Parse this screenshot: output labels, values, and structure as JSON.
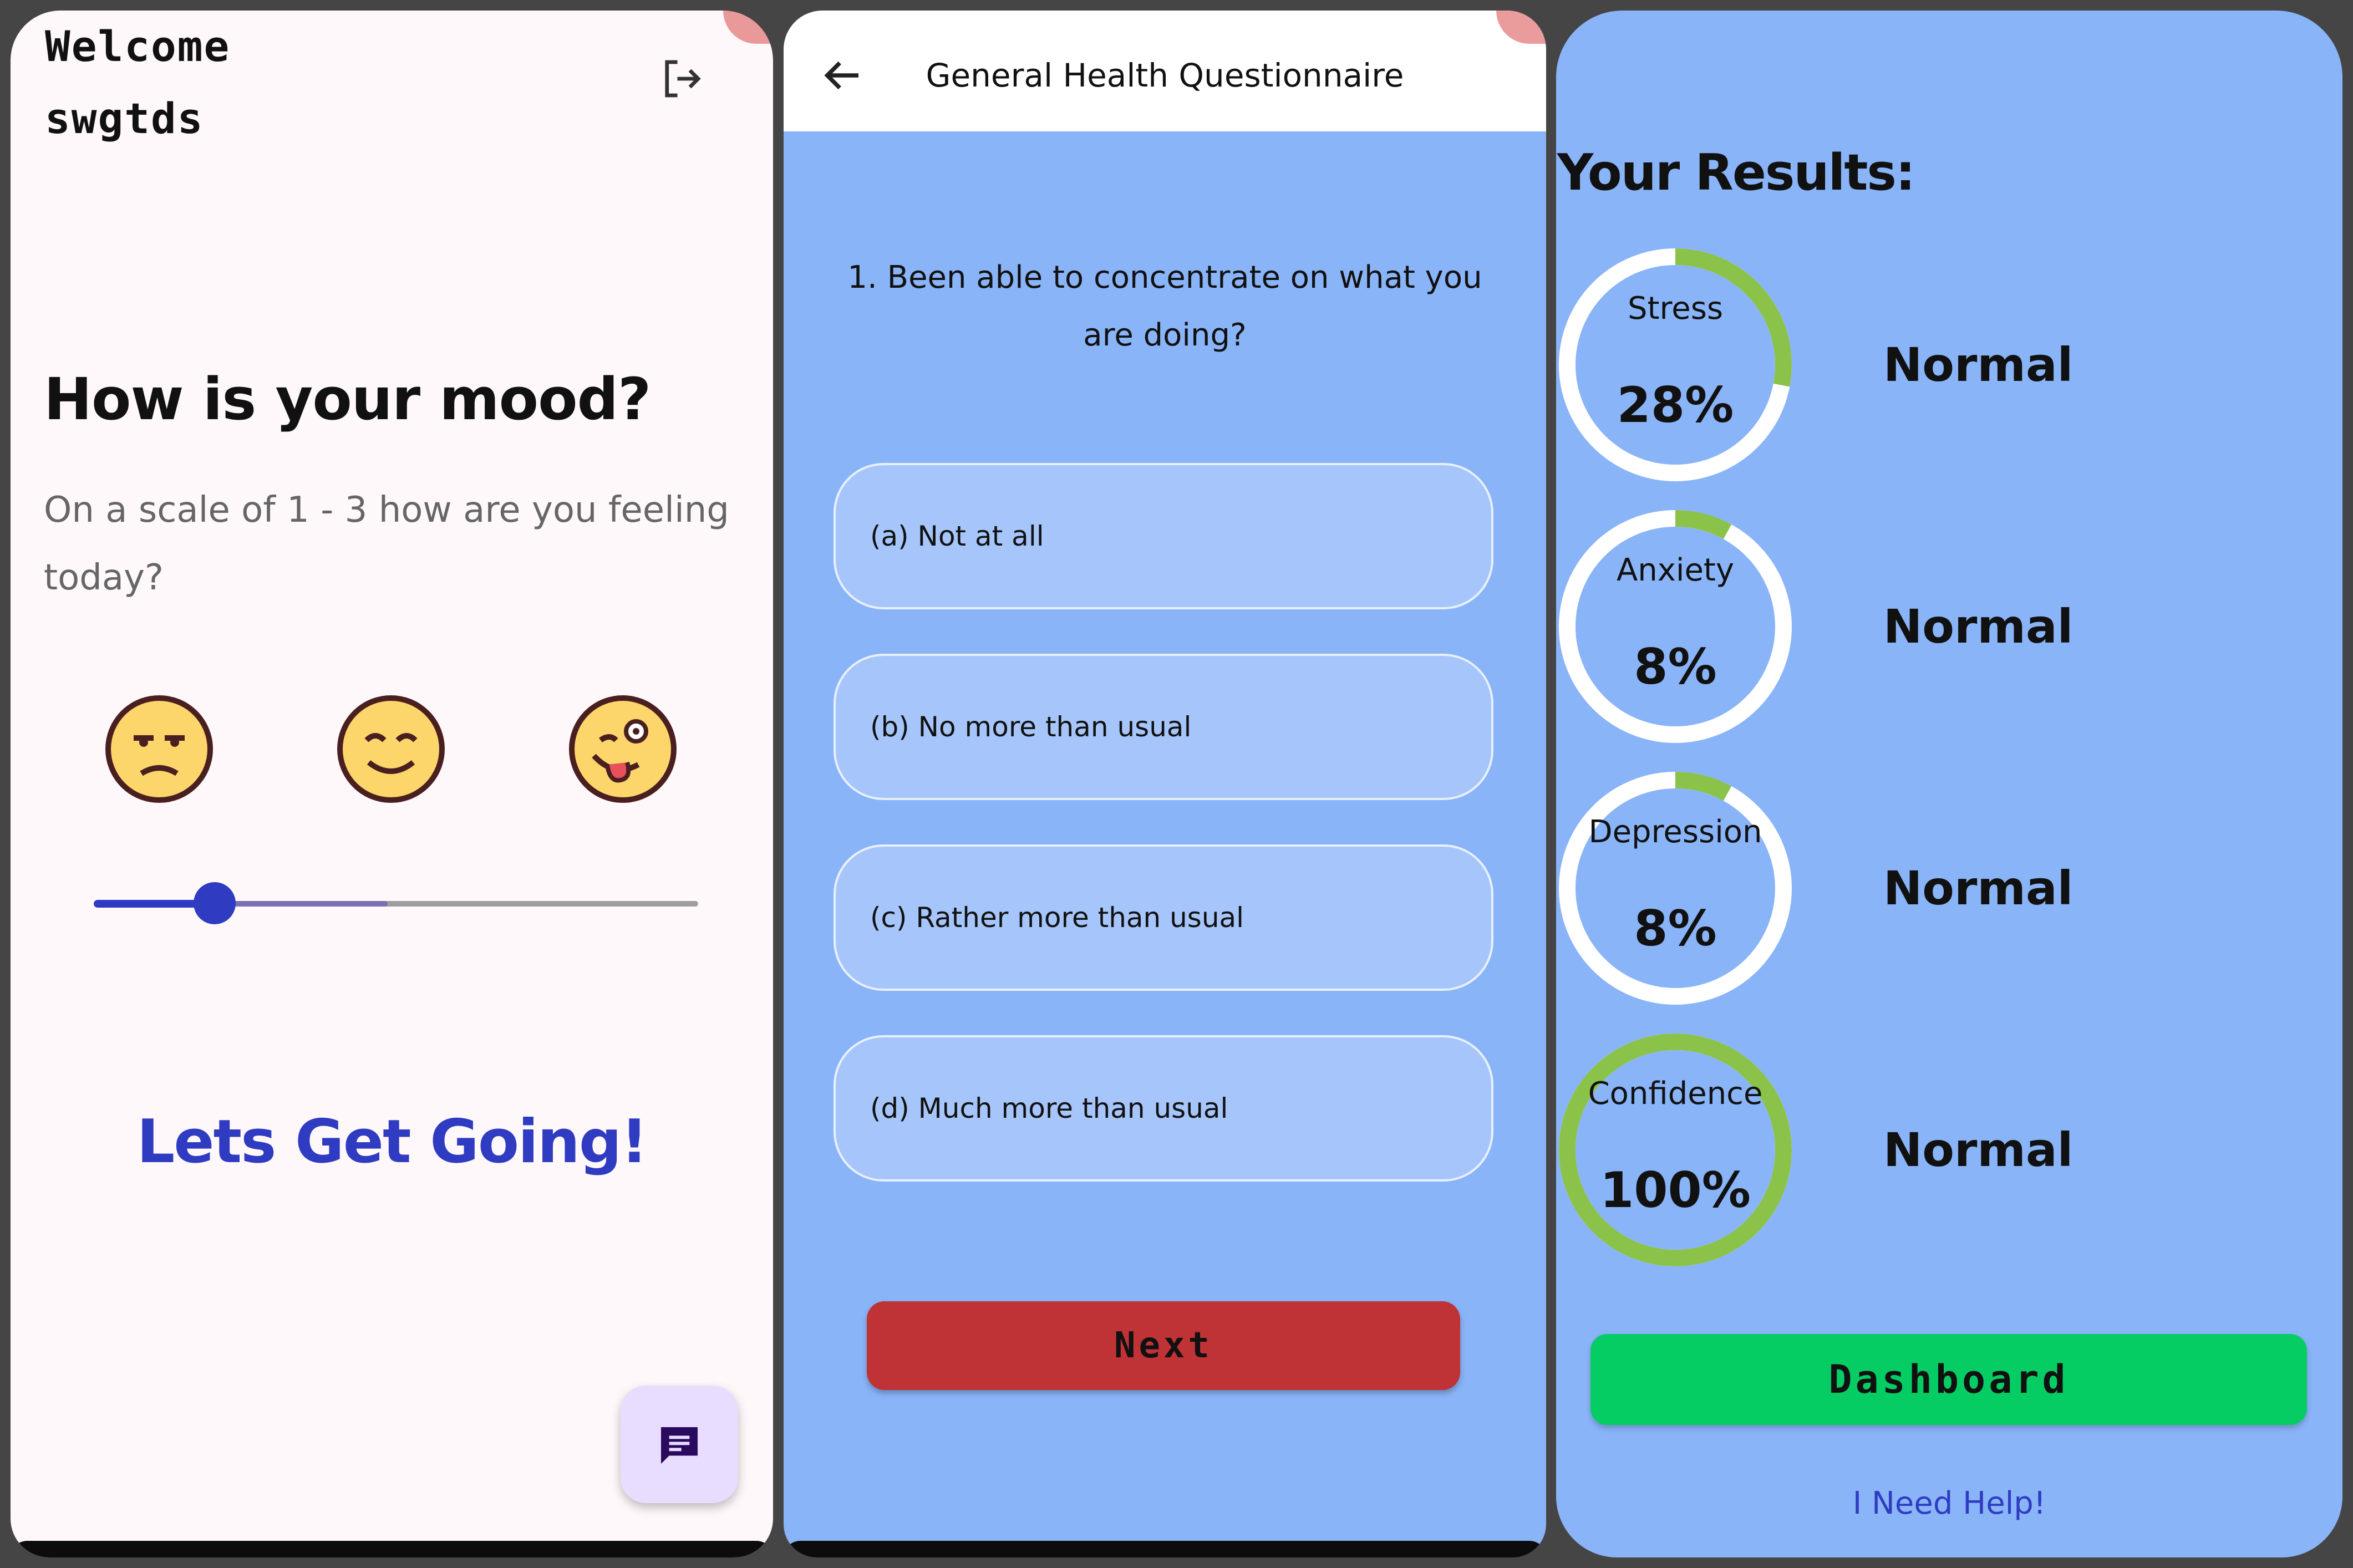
{
  "home": {
    "welcome_line1": "Welcome",
    "welcome_line2": "swgtds",
    "mood_title": "How is your mood?",
    "mood_subtitle": "On a scale of 1 - 3 how are you feeling today?",
    "emojis": [
      "annoyed-face-icon",
      "smiling-face-icon",
      "silly-face-icon"
    ],
    "slider": {
      "min": 1,
      "max": 3,
      "value": 1.4,
      "fill_color": "#2f3cc2"
    },
    "cta": "Lets Get Going!",
    "icons": {
      "logout": "logout-icon",
      "chat": "chat-icon"
    }
  },
  "questionnaire": {
    "title": "General Health Questionnaire",
    "question": "1. Been able to concentrate on what you are doing?",
    "options": [
      "(a) Not at all",
      "(b) No more than usual",
      "(c) Rather more than usual",
      "(d) Much more than usual"
    ],
    "next_label": "Next",
    "next_color": "#bf3236"
  },
  "results": {
    "title": "Your Results:",
    "items": [
      {
        "label": "Stress",
        "value": "28%",
        "percent": 28,
        "status": "Normal"
      },
      {
        "label": "Anxiety",
        "value": "8%",
        "percent": 8,
        "status": "Normal"
      },
      {
        "label": "Depression",
        "value": "8%",
        "percent": 8,
        "status": "Normal"
      },
      {
        "label": "Confidence",
        "value": "100%",
        "percent": 100,
        "status": "Normal"
      }
    ],
    "ring_color": "#8bc34a",
    "ring_track_color": "#ffffff",
    "dashboard_label": "Dashboard",
    "dashboard_color": "#05cc63",
    "help_label": "I Need Help!"
  }
}
